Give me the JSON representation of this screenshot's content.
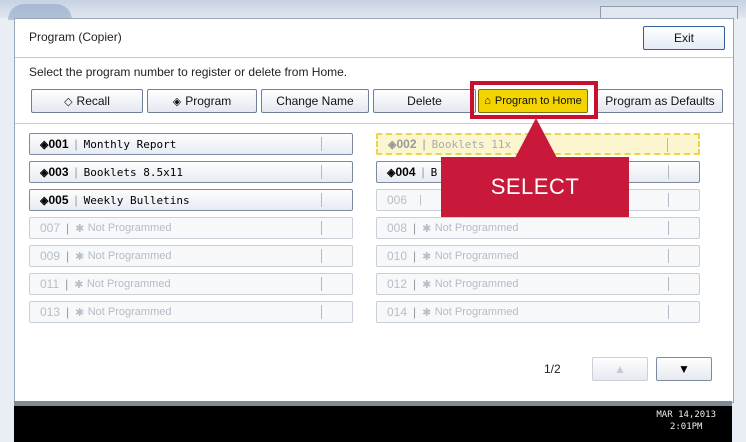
{
  "window": {
    "title": "Program (Copier)",
    "exit_label": "Exit"
  },
  "instruction": "Select the program number to register or delete from Home.",
  "actions": [
    {
      "label": "Recall",
      "icon": "◇"
    },
    {
      "label": "Program",
      "icon": "◈"
    },
    {
      "label": "Change Name"
    },
    {
      "label": "Delete"
    },
    {
      "label": "Program to Home",
      "icon": "⌂",
      "active": true
    },
    {
      "label": "Program as Defaults"
    }
  ],
  "programs": [
    {
      "num": "001",
      "name": "Monthly Report",
      "icon": "◈",
      "state": "programmed"
    },
    {
      "num": "002",
      "name": "Booklets  11x",
      "icon": "◈",
      "state": "selected"
    },
    {
      "num": "003",
      "name": "Booklets 8.5x11",
      "icon": "◈",
      "state": "programmed"
    },
    {
      "num": "004",
      "name": "B",
      "icon": "◈",
      "state": "programmed"
    },
    {
      "num": "005",
      "name": "Weekly Bulletins",
      "icon": "◈",
      "state": "programmed"
    },
    {
      "num": "006",
      "name": "|",
      "state": "disabled"
    },
    {
      "num": "007",
      "name": "Not Programmed",
      "icon": "✱",
      "state": "disabled"
    },
    {
      "num": "008",
      "name": "Not Programmed",
      "icon": "✱",
      "state": "disabled"
    },
    {
      "num": "009",
      "name": "Not Programmed",
      "icon": "✱",
      "state": "disabled"
    },
    {
      "num": "010",
      "name": "Not Programmed",
      "icon": "✱",
      "state": "disabled"
    },
    {
      "num": "011",
      "name": "Not Programmed",
      "icon": "✱",
      "state": "disabled"
    },
    {
      "num": "012",
      "name": "Not Programmed",
      "icon": "✱",
      "state": "disabled"
    },
    {
      "num": "013",
      "name": "Not Programmed",
      "icon": "✱",
      "state": "disabled"
    },
    {
      "num": "014",
      "name": "Not Programmed",
      "icon": "✱",
      "state": "disabled"
    }
  ],
  "pagination": {
    "indicator": "1/2",
    "up_icon": "▲",
    "down_icon": "▼"
  },
  "status": {
    "date": "MAR  14,2013",
    "time": "2:01PM"
  },
  "callout": {
    "text": "SELECT"
  },
  "colors": {
    "accent_yellow": "#f4d400",
    "callout_red": "#c8193b",
    "highlight_red": "#c8102e"
  }
}
